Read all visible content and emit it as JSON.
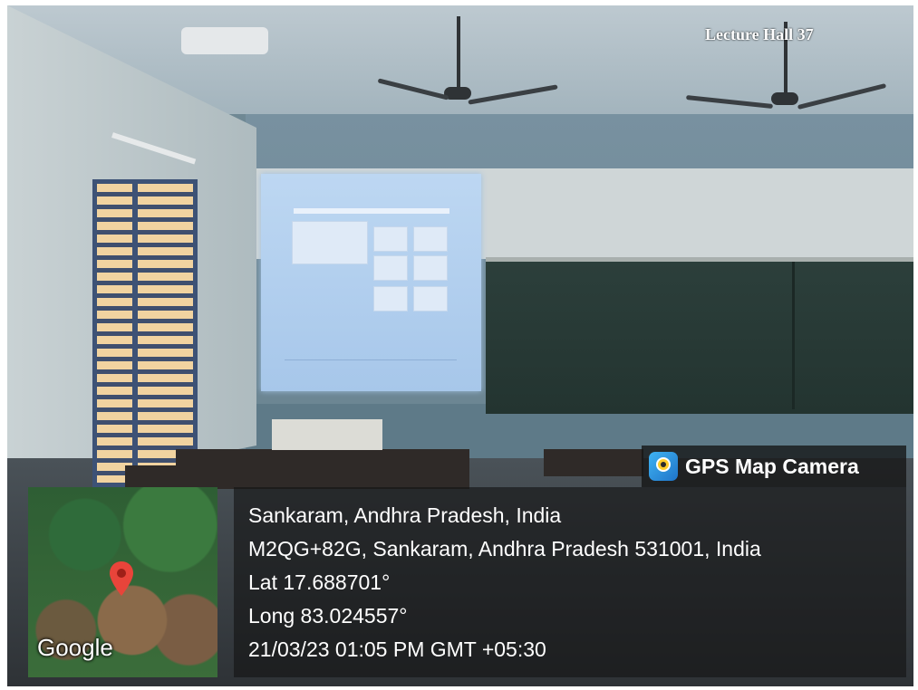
{
  "photo": {
    "room_label": "Lecture Hall 37"
  },
  "overlay": {
    "brand": {
      "icon": "gps-map-camera-icon",
      "label": "GPS Map Camera"
    },
    "map": {
      "marker_icon": "map-pin-icon",
      "attribution": "Google"
    },
    "location": {
      "place": "Sankaram, Andhra Pradesh, India",
      "address": "M2QG+82G, Sankaram, Andhra Pradesh 531001, India",
      "latitude": "Lat 17.688701°",
      "longitude": "Long 83.024557°",
      "timestamp": "21/03/23 01:05 PM GMT +05:30"
    }
  }
}
